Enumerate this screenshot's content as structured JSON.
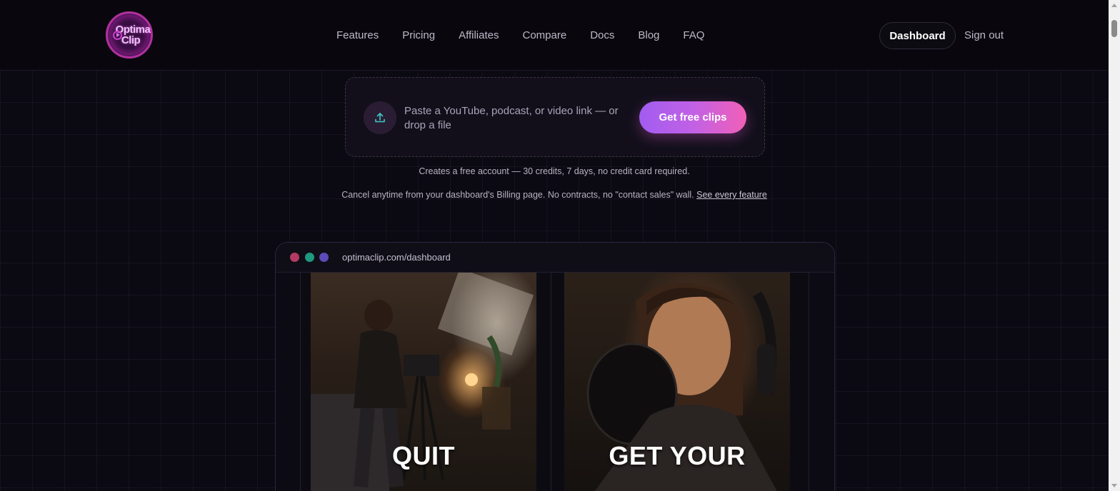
{
  "header": {
    "logo_line1": "Optima",
    "logo_line2": "Clip",
    "nav": [
      "Features",
      "Pricing",
      "Affiliates",
      "Compare",
      "Docs",
      "Blog",
      "FAQ"
    ],
    "dashboard_label": "Dashboard",
    "signout_label": "Sign out"
  },
  "upload": {
    "icon": "upload-icon",
    "placeholder": "Paste a YouTube, podcast, or video link — or drop a file",
    "cta_label": "Get free clips"
  },
  "notes": {
    "line1": "Creates a free account — 30 credits, 7 days, no credit card required.",
    "line2": "Cancel anytime from your dashboard's Billing page. No contracts, no \"contact sales\" wall.",
    "link": "See every feature"
  },
  "browser": {
    "url": "optimaclip.com/dashboard",
    "clips": [
      {
        "caption": "QUIT"
      },
      {
        "caption": "GET YOUR"
      }
    ]
  },
  "colors": {
    "background": "#0b0911",
    "cta_gradient_start": "#a25cf0",
    "cta_gradient_end": "#f160b6",
    "dot_red": "#b33a62",
    "dot_green": "#1f9880",
    "dot_blue": "#5b4ab8"
  }
}
